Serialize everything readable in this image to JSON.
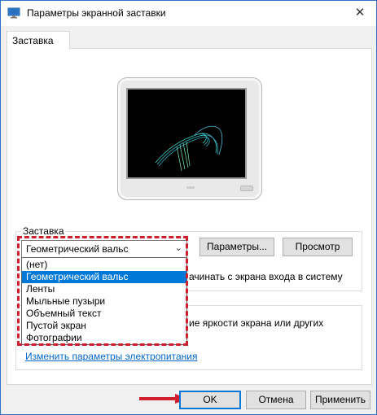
{
  "window": {
    "title": "Параметры экранной заставки",
    "close_symbol": "✕"
  },
  "tab": {
    "label": "Заставка"
  },
  "screensaver_group": {
    "legend": "Заставка",
    "selected": "Геометрический вальс",
    "options": [
      "(нет)",
      "Геометрический вальс",
      "Ленты",
      "Мыльные пузыри",
      "Объемный текст",
      "Пустой экран",
      "Фотографии"
    ],
    "selected_index": 1,
    "params_button": "Параметры...",
    "preview_button": "Просмотр",
    "resume_text_fragment": "ачинать с экрана входа в систему"
  },
  "power_group": {
    "text_fragment": "ие яркости экрана или других",
    "link": "Изменить параметры электропитания"
  },
  "buttons": {
    "ok": "OK",
    "cancel": "Отмена",
    "apply": "Применить"
  },
  "colors": {
    "highlight": "#0078d7",
    "annotation": "#cf1f2e",
    "link": "#0066cc",
    "screen_art": "#3fd0c9"
  }
}
